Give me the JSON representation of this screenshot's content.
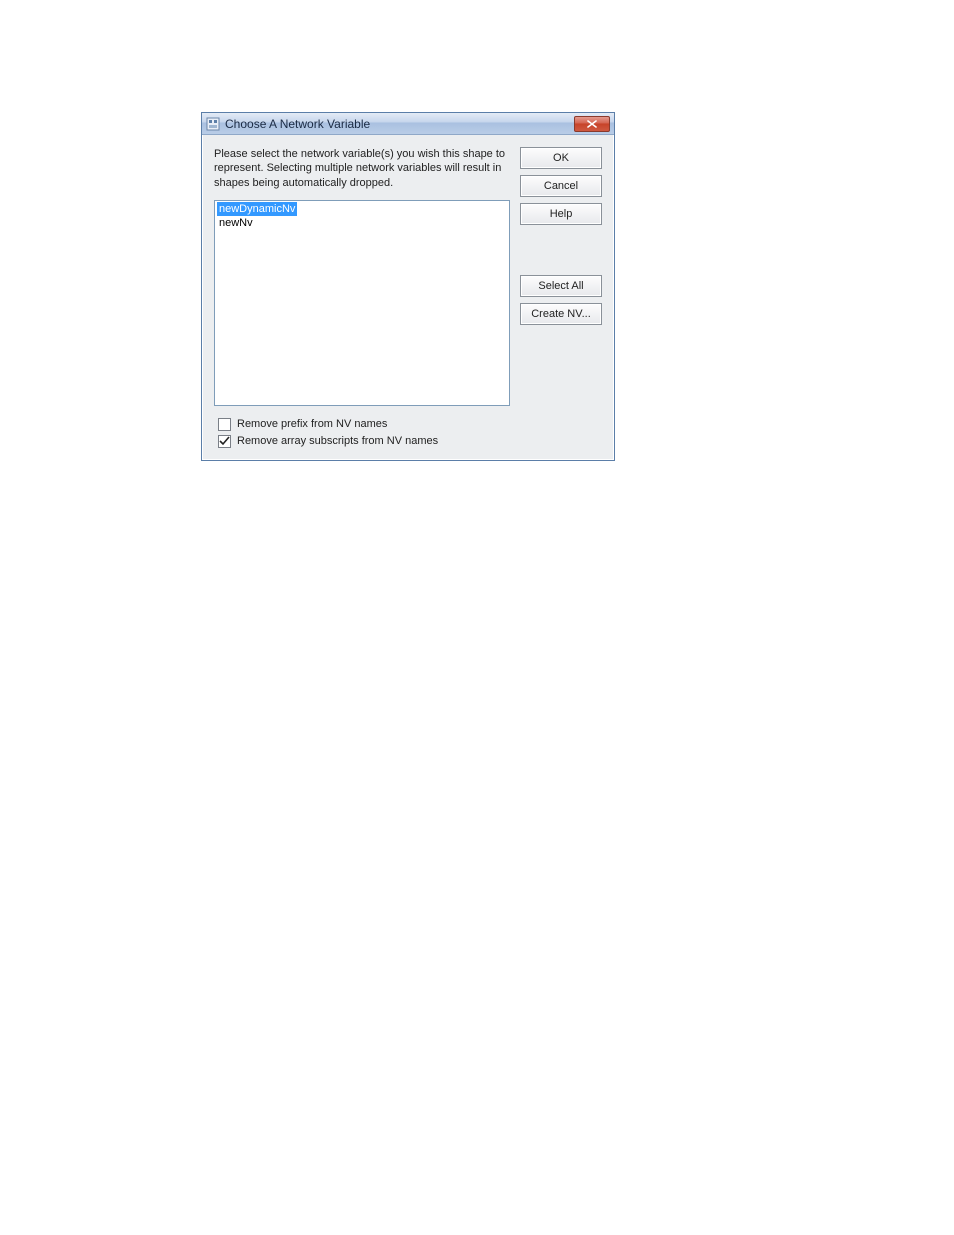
{
  "titlebar": {
    "title": "Choose A Network Variable"
  },
  "instruction": "Please select the network variable(s) you wish this shape to represent.  Selecting multiple network variables will result in shapes being automatically dropped.",
  "list": {
    "items": [
      {
        "label": "newDynamicNv",
        "selected": true
      },
      {
        "label": "newNv",
        "selected": false
      }
    ]
  },
  "buttons": {
    "ok": "OK",
    "cancel": "Cancel",
    "help": "Help",
    "select_all": "Select All",
    "create_nv": "Create NV..."
  },
  "options": {
    "remove_prefix": {
      "label": "Remove prefix from NV names",
      "checked": false
    },
    "remove_subscripts": {
      "label": "Remove array subscripts from NV names",
      "checked": true
    }
  }
}
